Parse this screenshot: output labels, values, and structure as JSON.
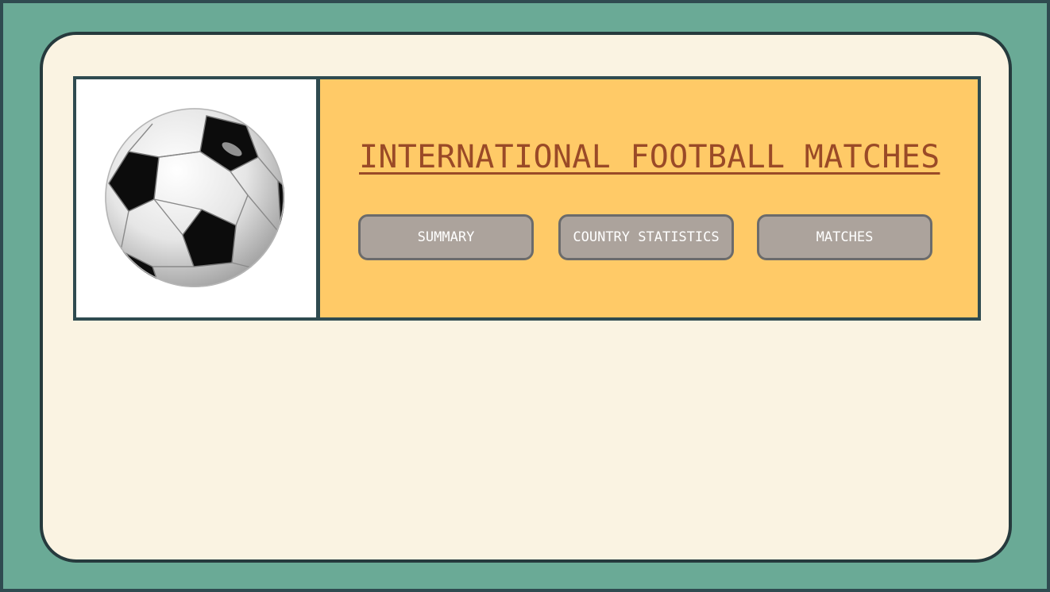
{
  "header": {
    "title": "INTERNATIONAL FOOTBALL MATCHES",
    "logo_icon": "soccer-ball-icon"
  },
  "nav": {
    "buttons": [
      {
        "label": "SUMMARY"
      },
      {
        "label": "COUNTRY STATISTICS"
      },
      {
        "label": "MATCHES"
      }
    ]
  },
  "colors": {
    "background": "#6aaa96",
    "card": "#faf3e2",
    "header": "#ffca67",
    "title": "#9a4a27",
    "button": "#aca39c",
    "border": "#2f4b50"
  }
}
